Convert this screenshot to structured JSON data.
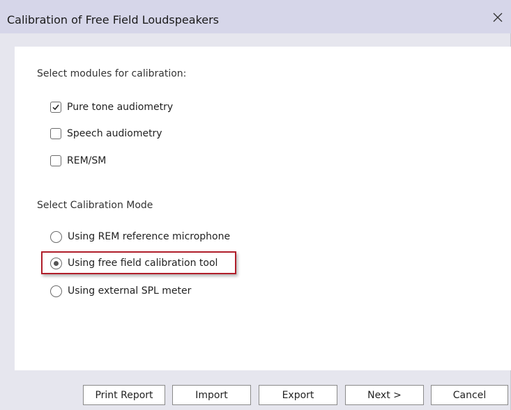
{
  "window": {
    "title": "Calibration of Free Field Loudspeakers",
    "close_icon": "close-icon"
  },
  "modules": {
    "heading": "Select modules for calibration:",
    "items": [
      {
        "label": "Pure tone audiometry",
        "checked": true
      },
      {
        "label": "Speech audiometry",
        "checked": false
      },
      {
        "label": "REM/SM",
        "checked": false
      }
    ]
  },
  "mode": {
    "heading": "Select Calibration Mode",
    "options": [
      {
        "label": "Using REM reference microphone",
        "selected": false
      },
      {
        "label": "Using free field calibration tool",
        "selected": true
      },
      {
        "label": "Using external SPL meter",
        "selected": false
      }
    ]
  },
  "buttons": {
    "print_report": "Print Report",
    "import": "Import",
    "export": "Export",
    "next": "Next >",
    "cancel": "Cancel"
  },
  "colors": {
    "titlebar": "#d6d6e9",
    "window_bg": "#e6e6ee",
    "highlight": "#b01e2a"
  }
}
